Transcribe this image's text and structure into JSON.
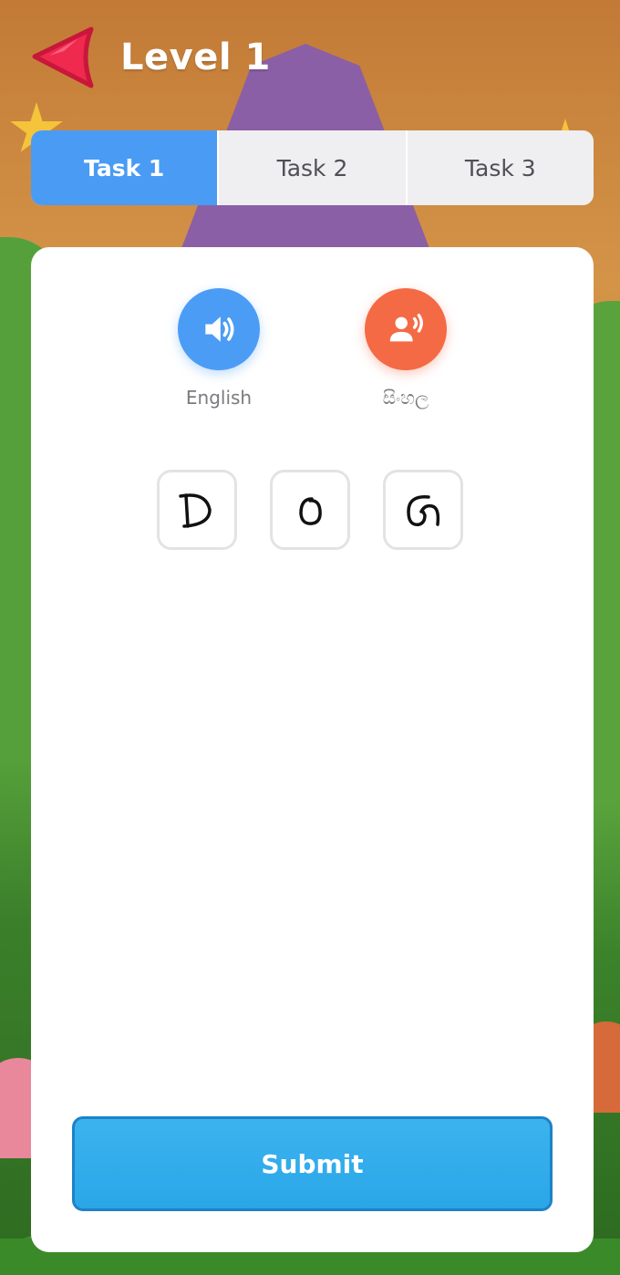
{
  "header": {
    "title": "Level 1",
    "back_icon": "back-arrow-icon",
    "back_color": "#f0294f"
  },
  "tabs": [
    {
      "label": "Task 1",
      "active": true
    },
    {
      "label": "Task 2",
      "active": false
    },
    {
      "label": "Task 3",
      "active": false
    }
  ],
  "audio": {
    "english": {
      "label": "English",
      "icon": "speaker-icon",
      "color": "#4b9cf5"
    },
    "sinhala": {
      "label": "සිංහල",
      "icon": "voice-person-icon",
      "color": "#f46a45"
    }
  },
  "letters": [
    "D",
    "O",
    "G"
  ],
  "submit_label": "Submit",
  "colors": {
    "active_tab": "#4a9bf4",
    "submit": "#2aa6e8"
  }
}
